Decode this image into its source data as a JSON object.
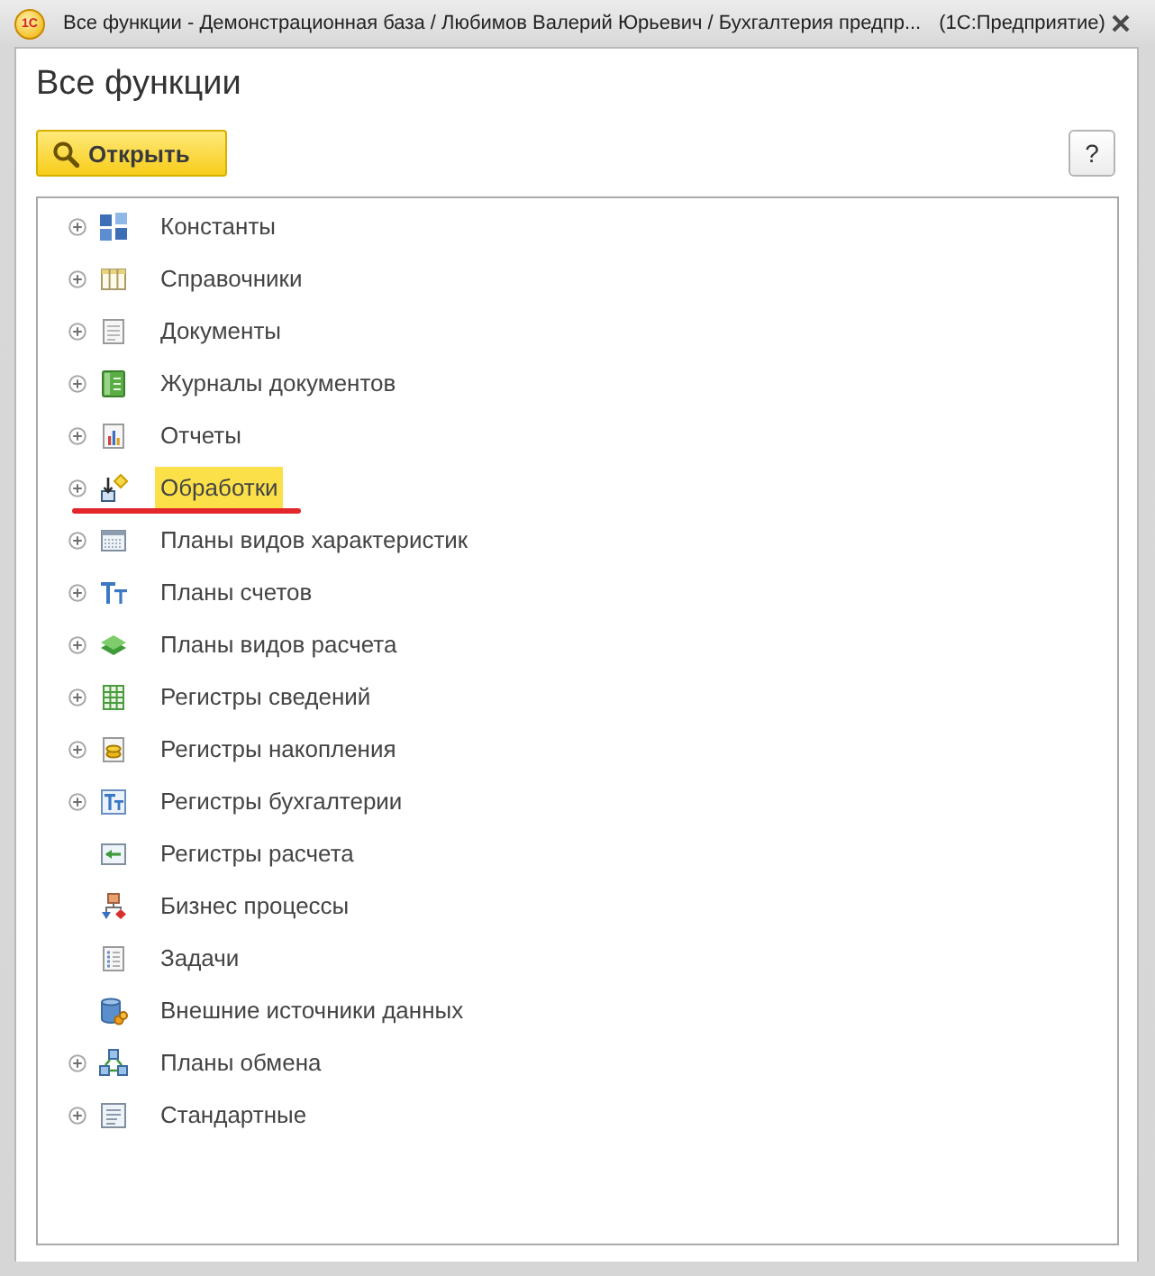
{
  "window": {
    "logo": "1С",
    "title": "Все функции - Демонстрационная база / Любимов Валерий Юрьевич / Бухгалтерия предпр...",
    "app_name": "(1С:Предприятие)"
  },
  "heading": "Все функции",
  "toolbar": {
    "open_button": "Открыть",
    "help_button": "?"
  },
  "tree": {
    "items": [
      {
        "label": "Константы",
        "expandable": true,
        "selected": false,
        "underlined": false
      },
      {
        "label": "Справочники",
        "expandable": true,
        "selected": false,
        "underlined": false
      },
      {
        "label": "Документы",
        "expandable": true,
        "selected": false,
        "underlined": false
      },
      {
        "label": "Журналы документов",
        "expandable": true,
        "selected": false,
        "underlined": false
      },
      {
        "label": "Отчеты",
        "expandable": true,
        "selected": false,
        "underlined": false
      },
      {
        "label": "Обработки",
        "expandable": true,
        "selected": true,
        "underlined": true
      },
      {
        "label": "Планы видов характеристик",
        "expandable": true,
        "selected": false,
        "underlined": false
      },
      {
        "label": "Планы счетов",
        "expandable": true,
        "selected": false,
        "underlined": false
      },
      {
        "label": "Планы видов расчета",
        "expandable": true,
        "selected": false,
        "underlined": false
      },
      {
        "label": "Регистры сведений",
        "expandable": true,
        "selected": false,
        "underlined": false
      },
      {
        "label": "Регистры накопления",
        "expandable": true,
        "selected": false,
        "underlined": false
      },
      {
        "label": "Регистры бухгалтерии",
        "expandable": true,
        "selected": false,
        "underlined": false
      },
      {
        "label": "Регистры расчета",
        "expandable": false,
        "selected": false,
        "underlined": false
      },
      {
        "label": "Бизнес процессы",
        "expandable": false,
        "selected": false,
        "underlined": false
      },
      {
        "label": "Задачи",
        "expandable": false,
        "selected": false,
        "underlined": false
      },
      {
        "label": "Внешние источники данных",
        "expandable": false,
        "selected": false,
        "underlined": false
      },
      {
        "label": "Планы обмена",
        "expandable": true,
        "selected": false,
        "underlined": false
      },
      {
        "label": "Стандартные",
        "expandable": true,
        "selected": false,
        "underlined": false
      }
    ]
  }
}
